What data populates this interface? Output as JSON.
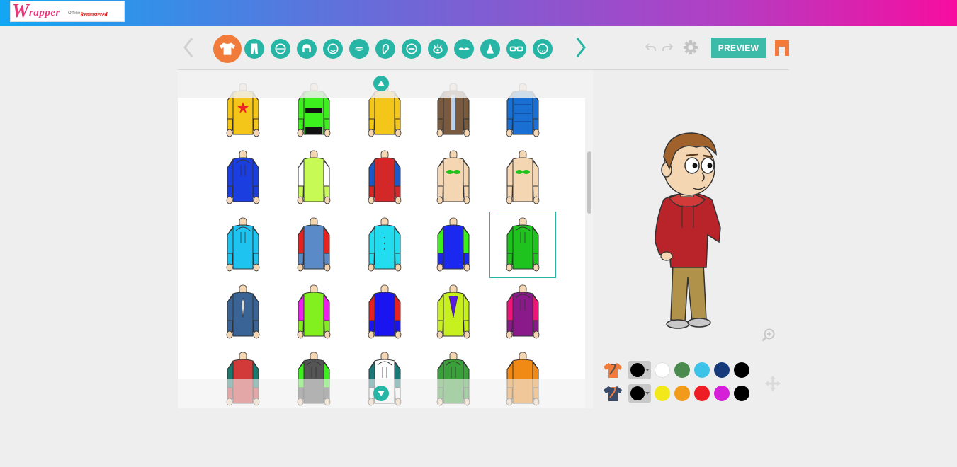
{
  "app": {
    "logo_letter": "W",
    "logo_word": "rapper",
    "logo_offline": "Offline",
    "logo_remastered": "Remastered"
  },
  "toolbar": {
    "preview_label": "PREVIEW",
    "categories": [
      "upper-body",
      "lower-body",
      "head-shape",
      "hair",
      "face-shape",
      "mouth",
      "ear",
      "eyebrows",
      "eye",
      "mustache",
      "nose",
      "glasses",
      "beard"
    ]
  },
  "colors": {
    "accent": "#27b6a5",
    "active_tab": "#f07b3a",
    "primary_row": [
      "#ffffff",
      "#4a8a4e",
      "#3ec3e8",
      "#173a7a",
      "#000000"
    ],
    "secondary_row": [
      "#f2e81a",
      "#f29a1a",
      "#ee1c24",
      "#d620d8",
      "#000000"
    ]
  },
  "items": [
    {
      "body": "#f4c61a",
      "sleeve": "#f4c61a",
      "detail": "star"
    },
    {
      "body": "#3cf01e",
      "sleeve": "#3cf01e",
      "detail": "stripe"
    },
    {
      "body": "#f4c61a",
      "sleeve": "#f4c61a",
      "detail": "none"
    },
    {
      "body": "#7a5a3e",
      "sleeve": "#7a5a3e",
      "detail": "jacket"
    },
    {
      "body": "#1a70d2",
      "sleeve": "#1a70d2",
      "detail": "puffer"
    },
    {
      "body": "#1a3ee0",
      "sleeve": "#1a3ee0",
      "detail": "hoodie"
    },
    {
      "body": "#c8fa55",
      "sleeve": "#ffffff",
      "detail": "none"
    },
    {
      "body": "#d42828",
      "sleeve": "#1a5ac8",
      "detail": "none"
    },
    {
      "body": "#f5d6b3",
      "sleeve": "#f5d6b3",
      "detail": "bikini"
    },
    {
      "body": "#f5d6b3",
      "sleeve": "#f5d6b3",
      "detail": "bikini"
    },
    {
      "body": "#1ec3f0",
      "sleeve": "#1ec3f0",
      "detail": "hoodie"
    },
    {
      "body": "#5a8ac8",
      "sleeve": "#e82020",
      "detail": "none"
    },
    {
      "body": "#22dcf0",
      "sleeve": "#22dcf0",
      "detail": "buttons"
    },
    {
      "body": "#1a28f0",
      "sleeve": "#3cf01e",
      "detail": "none"
    },
    {
      "body": "#1ec31e",
      "sleeve": "#1ec31e",
      "detail": "hoodie"
    },
    {
      "body": "#3a6496",
      "sleeve": "#3a6496",
      "detail": "tie"
    },
    {
      "body": "#82f01e",
      "sleeve": "#f01ef0",
      "detail": "none"
    },
    {
      "body": "#1a14f0",
      "sleeve": "#e82020",
      "detail": "none"
    },
    {
      "body": "#c8f01e",
      "sleeve": "#c8f01e",
      "detail": "vest"
    },
    {
      "body": "#8a1a8a",
      "sleeve": "#f0147a",
      "detail": "hoodie"
    },
    {
      "body": "#d23a3a",
      "sleeve": "#1a7a6e",
      "detail": "none"
    },
    {
      "body": "#555555",
      "sleeve": "#3cf01e",
      "detail": "hoodie"
    },
    {
      "body": "#ffffff",
      "sleeve": "#1a7a7a",
      "detail": "hoodie"
    },
    {
      "body": "#3aa03a",
      "sleeve": "#3aa03a",
      "detail": "hoodie"
    },
    {
      "body": "#f08a14",
      "sleeve": "#f08a14",
      "detail": "none"
    }
  ],
  "selected_index": 14
}
